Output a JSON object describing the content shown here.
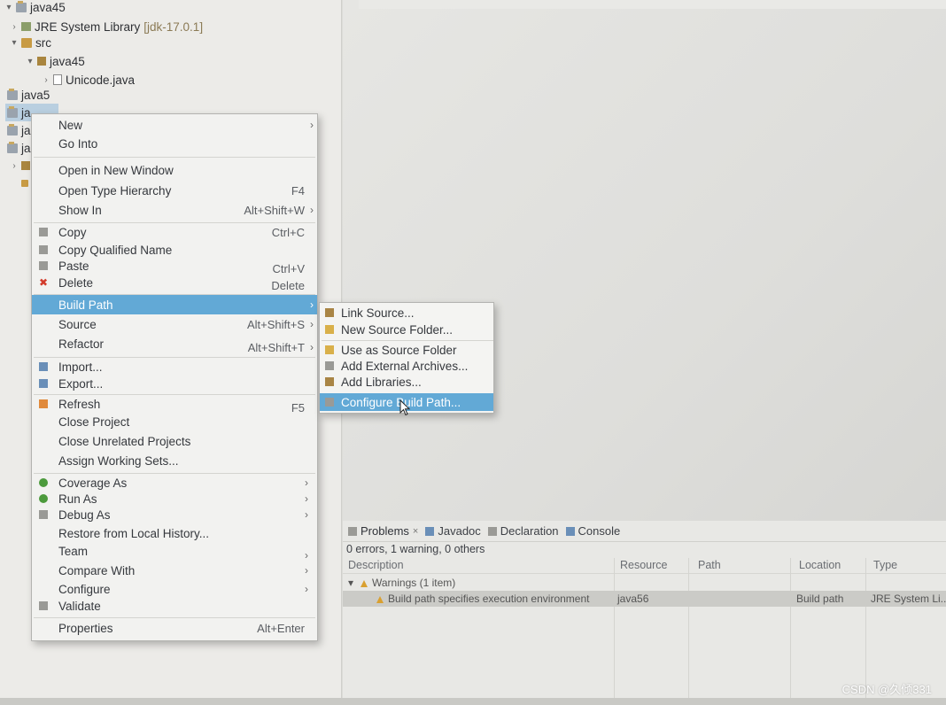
{
  "explorer": {
    "rows": [
      {
        "label": "java45",
        "suffix": "",
        "icon": "project-icon",
        "twisty": "▾"
      },
      {
        "label": "JRE System Library",
        "suffix": "[jdk-17.0.1]",
        "icon": "library-icon",
        "twisty": "›"
      },
      {
        "label": "src",
        "suffix": "",
        "icon": "source-folder-icon",
        "twisty": "▾"
      },
      {
        "label": "java45",
        "suffix": "",
        "icon": "package-icon",
        "twisty": "▾"
      },
      {
        "label": "Unicode.java",
        "suffix": "",
        "icon": "java-file-icon",
        "twisty": "›"
      },
      {
        "label": "java5",
        "suffix": "",
        "icon": "project-icon",
        "twisty": ""
      },
      {
        "label": "ja",
        "suffix": "",
        "icon": "project-icon",
        "twisty": ""
      },
      {
        "label": "ja",
        "suffix": "",
        "icon": "project-icon",
        "twisty": ""
      },
      {
        "label": "ja",
        "suffix": "",
        "icon": "project-icon",
        "twisty": ""
      }
    ]
  },
  "context_menu": {
    "items": {
      "new": {
        "label": "New",
        "arrow": "›"
      },
      "go_into": {
        "label": "Go Into"
      },
      "open_new_window": {
        "label": "Open in New Window"
      },
      "open_type_hierarchy": {
        "label": "Open Type Hierarchy",
        "shortcut": "F4"
      },
      "show_in": {
        "label": "Show In",
        "shortcut": "Alt+Shift+W",
        "arrow": "›"
      },
      "copy": {
        "label": "Copy",
        "shortcut": "Ctrl+C"
      },
      "copy_qualified": {
        "label": "Copy Qualified Name"
      },
      "paste": {
        "label": "Paste",
        "shortcut": "Ctrl+V"
      },
      "delete": {
        "label": "Delete",
        "shortcut": "Delete"
      },
      "build_path": {
        "label": "Build Path",
        "arrow": "›"
      },
      "source": {
        "label": "Source",
        "shortcut": "Alt+Shift+S",
        "arrow": "›"
      },
      "refactor": {
        "label": "Refactor",
        "shortcut": "Alt+Shift+T",
        "arrow": "›"
      },
      "import": {
        "label": "Import..."
      },
      "export": {
        "label": "Export..."
      },
      "refresh": {
        "label": "Refresh",
        "shortcut": "F5"
      },
      "close_project": {
        "label": "Close Project"
      },
      "close_unrelated": {
        "label": "Close Unrelated Projects"
      },
      "assign_working_sets": {
        "label": "Assign Working Sets..."
      },
      "coverage_as": {
        "label": "Coverage As",
        "arrow": "›"
      },
      "run_as": {
        "label": "Run As",
        "arrow": "›"
      },
      "debug_as": {
        "label": "Debug As",
        "arrow": "›"
      },
      "restore_history": {
        "label": "Restore from Local History..."
      },
      "team": {
        "label": "Team",
        "arrow": "›"
      },
      "compare_with": {
        "label": "Compare With",
        "arrow": "›"
      },
      "configure": {
        "label": "Configure",
        "arrow": "›"
      },
      "validate": {
        "label": "Validate"
      },
      "properties": {
        "label": "Properties",
        "shortcut": "Alt+Enter"
      }
    }
  },
  "submenu": {
    "link_source": "Link Source...",
    "new_source_folder": "New Source Folder...",
    "use_as_source_folder": "Use as Source Folder",
    "add_external_archives": "Add External Archives...",
    "add_libraries": "Add Libraries...",
    "configure_build_path": "Configure Build Path..."
  },
  "problems_view": {
    "tabs": {
      "problems": "Problems",
      "problems_close": "×",
      "javadoc": "Javadoc",
      "declaration": "Declaration",
      "console": "Console"
    },
    "summary": "0 errors, 1 warning, 0 others",
    "columns": {
      "description": "Description",
      "resource": "Resource",
      "path": "Path",
      "location": "Location",
      "type": "Type"
    },
    "group": {
      "twisty": "▾",
      "label": "Warnings (1 item)"
    },
    "row": {
      "description": "Build path specifies execution environment",
      "resource": "java56",
      "path": "",
      "location": "Build path",
      "type": "JRE System Li..."
    }
  },
  "watermark": "CSDN @久倾331",
  "colors": {
    "menu_highlight": "#62a9d6",
    "menu_background": "#f2f2f0",
    "warning": "#d9a030",
    "delete_icon": "#d23b2b"
  }
}
